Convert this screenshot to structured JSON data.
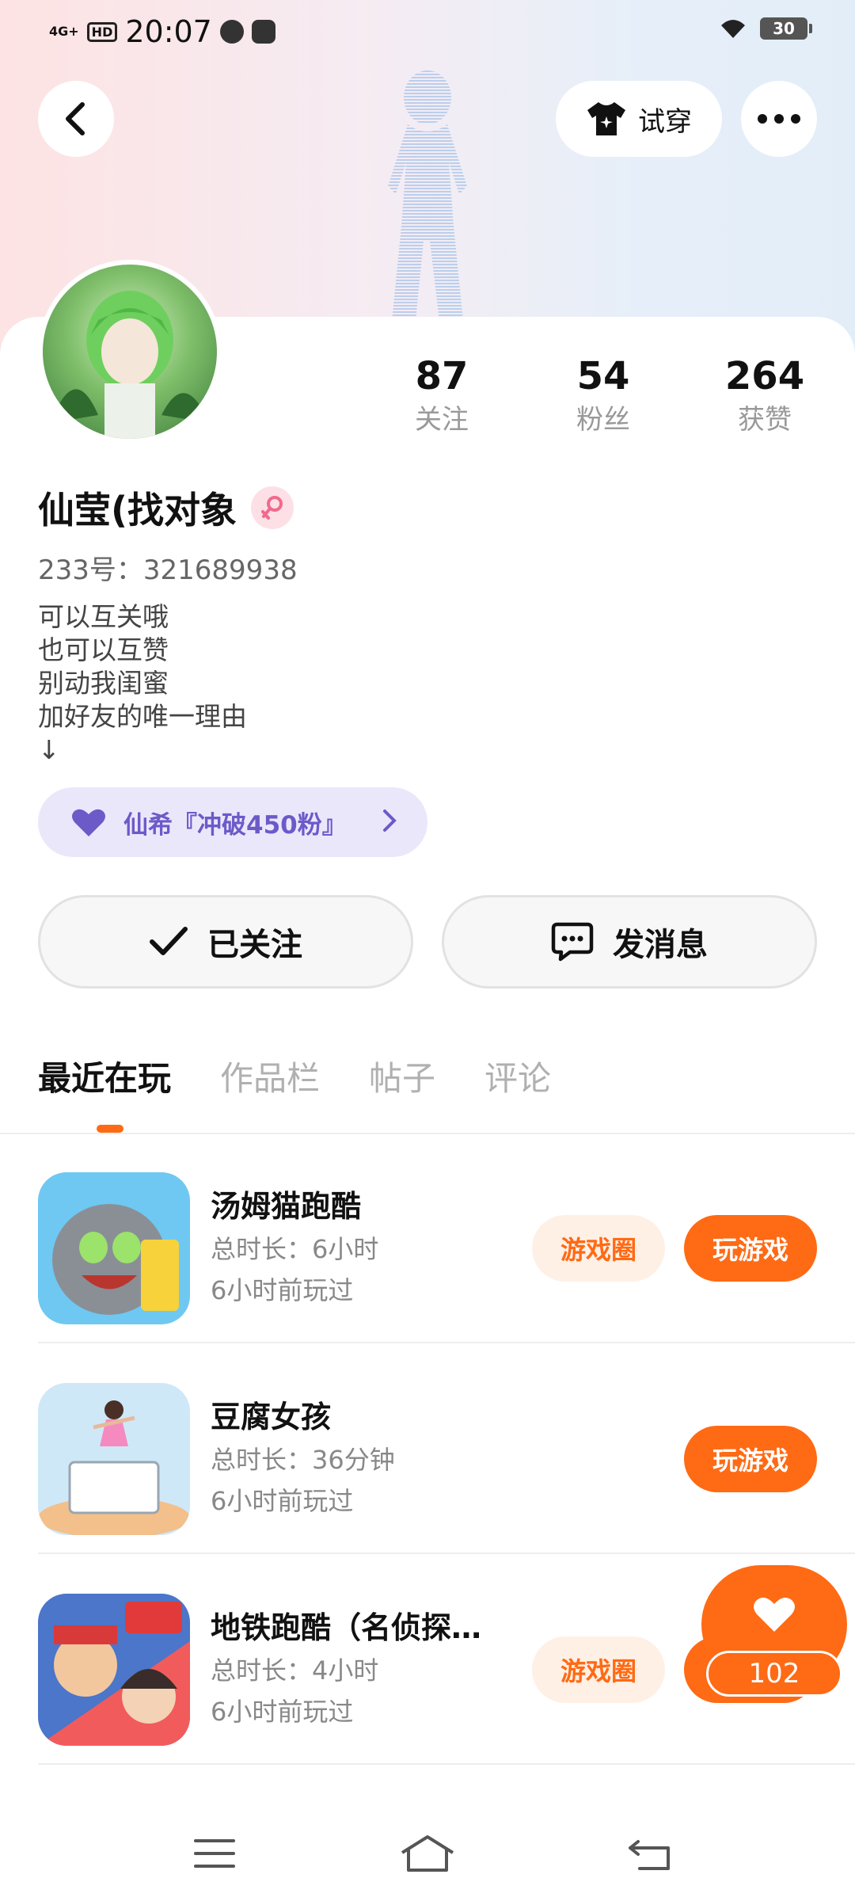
{
  "status_bar": {
    "network": "4G+",
    "hd": "HD",
    "time": "20:07",
    "battery": "30"
  },
  "header": {
    "try_on_label": "试穿"
  },
  "profile": {
    "name": "仙莹(找对象",
    "uid": "233号：321689938",
    "bio": "可以互关哦\n也可以互赞\n别动我闺蜜\n加好友的唯一理由\n↓",
    "stats": [
      {
        "value": "87",
        "label": "关注"
      },
      {
        "value": "54",
        "label": "粉丝"
      },
      {
        "value": "264",
        "label": "获赞"
      }
    ],
    "fan_group": "仙希『冲破450粉』"
  },
  "actions": {
    "followed_label": "已关注",
    "message_label": "发消息"
  },
  "tabs": [
    "最近在玩",
    "作品栏",
    "帖子",
    "评论"
  ],
  "games": [
    {
      "title": "汤姆猫跑酷",
      "duration": "总时长：6小时",
      "last_played": "6小时前玩过",
      "circle_label": "游戏圈",
      "play_label": "玩游戏"
    },
    {
      "title": "豆腐女孩",
      "duration": "总时长：36分钟",
      "last_played": "6小时前玩过",
      "play_label": "玩游戏"
    },
    {
      "title": "地铁跑酷（名侦探…",
      "duration": "总时长：4小时",
      "last_played": "6小时前玩过",
      "circle_label": "游戏圈",
      "play_label": "玩游戏"
    }
  ],
  "float_like": {
    "count": "102"
  },
  "colors": {
    "accent": "#ff6a14",
    "fan_purple": "#6c5ac9"
  },
  "icons": {
    "back": "chevron-left-icon",
    "try_on": "tshirt-icon",
    "more": "more-dots-icon",
    "gender": "female-icon",
    "heart": "heart-icon",
    "check": "check-icon",
    "chat": "chat-bubble-icon",
    "nav": [
      "menu-icon",
      "home-icon",
      "back-arrow-icon"
    ]
  }
}
